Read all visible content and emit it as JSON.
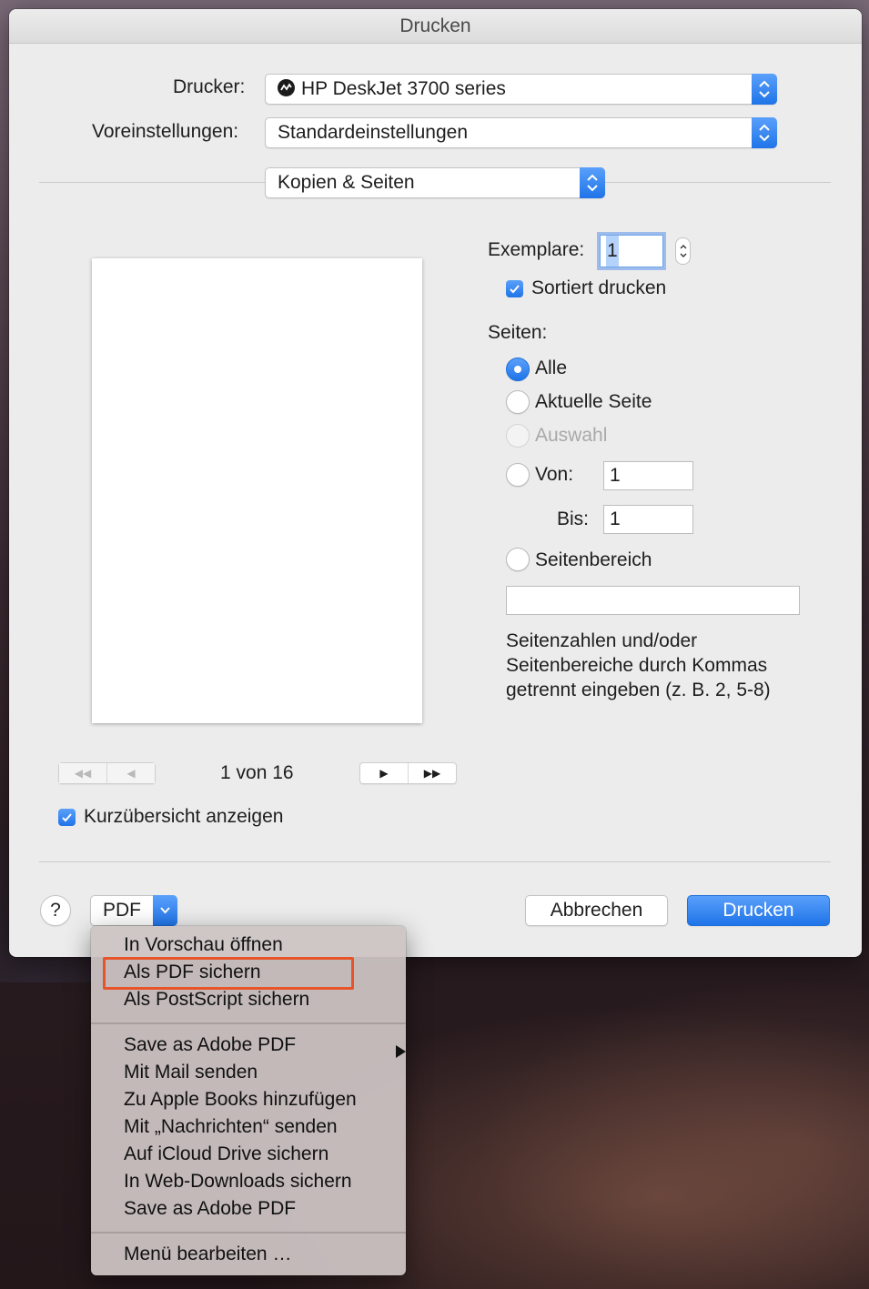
{
  "dialog": {
    "title": "Drucken"
  },
  "printer": {
    "label": "Drucker:",
    "value": "HP DeskJet 3700 series"
  },
  "presets": {
    "label": "Voreinstellungen:",
    "value": "Standardeinstellungen"
  },
  "section": {
    "value": "Kopien & Seiten"
  },
  "copies": {
    "label": "Exemplare:",
    "value": "1",
    "collate_label": "Sortiert drucken"
  },
  "pages": {
    "label": "Seiten:",
    "all": "Alle",
    "current": "Aktuelle Seite",
    "selection": "Auswahl",
    "from_label": "Von:",
    "from_value": "1",
    "to_label": "Bis:",
    "to_value": "1",
    "range_label": "Seitenbereich",
    "range_value": "",
    "hint_line1": "Seitenzahlen und/oder",
    "hint_line2": "Seitenbereiche durch Kommas",
    "hint_line3": "getrennt eingeben (z. B. 2, 5-8)"
  },
  "preview": {
    "page_indicator": "1 von 16",
    "show_details_label": "Kurzübersicht anzeigen"
  },
  "footer": {
    "help": "?",
    "pdf": "PDF",
    "cancel": "Abbrechen",
    "print": "Drucken"
  },
  "pdf_menu": {
    "items": [
      "In Vorschau öffnen",
      "Als PDF sichern",
      "Als PostScript sichern",
      "Save as Adobe PDF",
      "Mit Mail senden",
      "Zu Apple Books hinzufügen",
      "Mit „Nachrichten“ senden",
      "Auf iCloud Drive sichern",
      "In Web-Downloads sichern",
      "Save as Adobe PDF",
      "Menü bearbeiten …"
    ],
    "highlighted_index": 1
  },
  "colors": {
    "accent": "#1f74e8",
    "highlight_box": "#e8542a"
  }
}
